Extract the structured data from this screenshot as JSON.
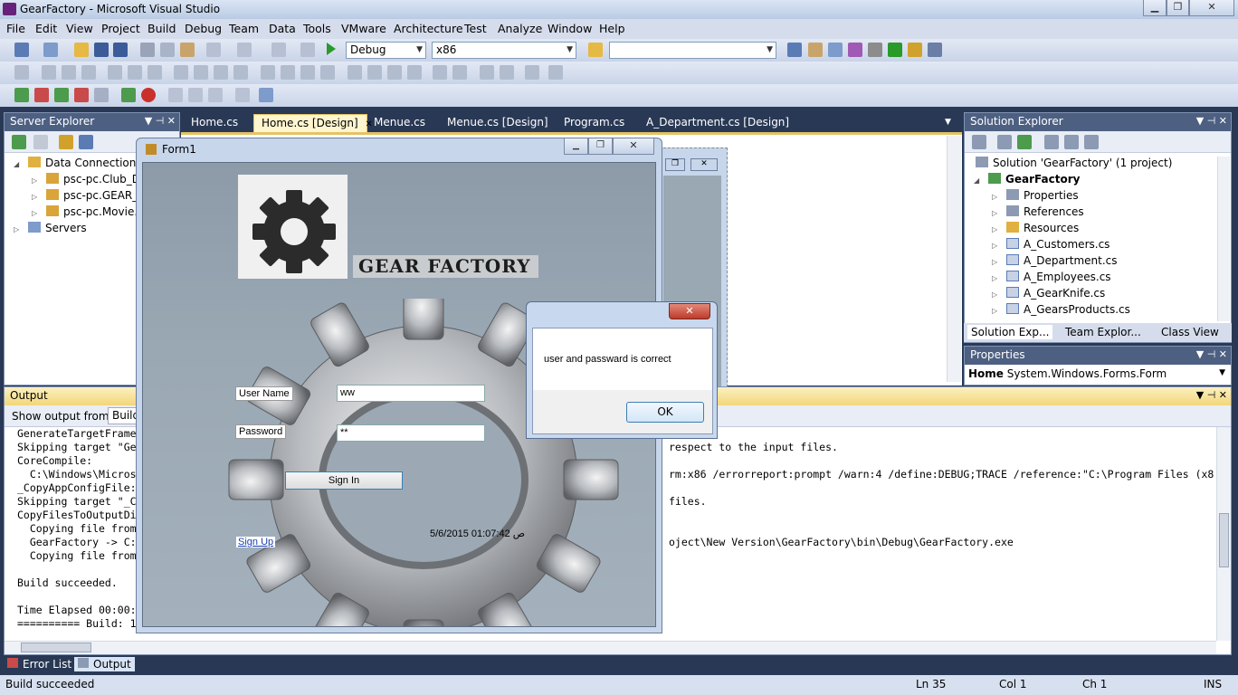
{
  "window": {
    "title": "GearFactory - Microsoft Visual Studio",
    "min": "▁",
    "max": "❐",
    "close": "✕"
  },
  "menu": [
    "File",
    "Edit",
    "View",
    "Project",
    "Build",
    "Debug",
    "Team",
    "Data",
    "Tools",
    "VMware",
    "Architecture",
    "Test",
    "Analyze",
    "Window",
    "Help"
  ],
  "toolbar": {
    "config": "Debug",
    "platform": "x86",
    "find": ""
  },
  "server_explorer": {
    "title": "Server Explorer",
    "pin": "▼ ⊣ ✕",
    "items": [
      {
        "label": "Data Connections",
        "expanded": true
      },
      {
        "label": "psc-pc.Club_D"
      },
      {
        "label": "psc-pc.GEAR_"
      },
      {
        "label": "psc-pc.Movie."
      },
      {
        "label": "Servers"
      }
    ]
  },
  "doc_tabs": [
    "Home.cs",
    "Home.cs [Design]",
    "Menue.cs",
    "Menue.cs [Design]",
    "Program.cs",
    "A_Department.cs [Design]"
  ],
  "form1": {
    "title": "Form1",
    "heading": "GEAR FACTORY",
    "username_label": "User Name",
    "username_value": "ww",
    "password_label": "Password",
    "password_value": "**",
    "signin": "Sign In",
    "signup": "Sign Up",
    "datetime": "5/6/2015 01:07:42 ص"
  },
  "msgbox": {
    "text": "user and passward is correct",
    "ok": "OK",
    "close": "✕"
  },
  "solution_explorer": {
    "title": "Solution Explorer",
    "solution": "Solution 'GearFactory' (1 project)",
    "project": "GearFactory",
    "items": [
      "Properties",
      "References",
      "Resources",
      "A_Customers.cs",
      "A_Department.cs",
      "A_Employees.cs",
      "A_GearKnife.cs",
      "A_GearsProducts.cs"
    ],
    "tabs": [
      "Solution Exp...",
      "Team Explor...",
      "Class View"
    ]
  },
  "properties": {
    "title": "Properties",
    "object": "Home",
    "type": "System.Windows.Forms.Form"
  },
  "output": {
    "title": "Output",
    "show_from_label": "Show output from:",
    "show_from_value": "Build",
    "left_lines": [
      "GenerateTargetFrame",
      "Skipping target \"Ge",
      "CoreCompile:",
      "  C:\\Windows\\Micros",
      "_CopyAppConfigFile:",
      "Skipping target \"_C",
      "CopyFilesToOutputDi",
      "  Copying file from",
      "  GearFactory -> C:",
      "  Copying file from",
      "",
      "Build succeeded.",
      "",
      "Time Elapsed 00:00:",
      "========== Build: 1"
    ],
    "right_lines": [
      {
        "row": 1,
        "text": "respect to the input files."
      },
      {
        "row": 3,
        "text": "rm:x86 /errorreport:prompt /warn:4 /define:DEBUG;TRACE /reference:\"C:\\Program Files (x8"
      },
      {
        "row": 5,
        "text": "files."
      },
      {
        "row": 8,
        "text": "oject\\New Version\\GearFactory\\bin\\Debug\\GearFactory.exe"
      }
    ]
  },
  "bottom_tabs": [
    "Error List",
    "Output"
  ],
  "status": {
    "text": "Build succeeded",
    "ln": "Ln 35",
    "col": "Col 1",
    "ch": "Ch 1",
    "ins": "INS"
  }
}
